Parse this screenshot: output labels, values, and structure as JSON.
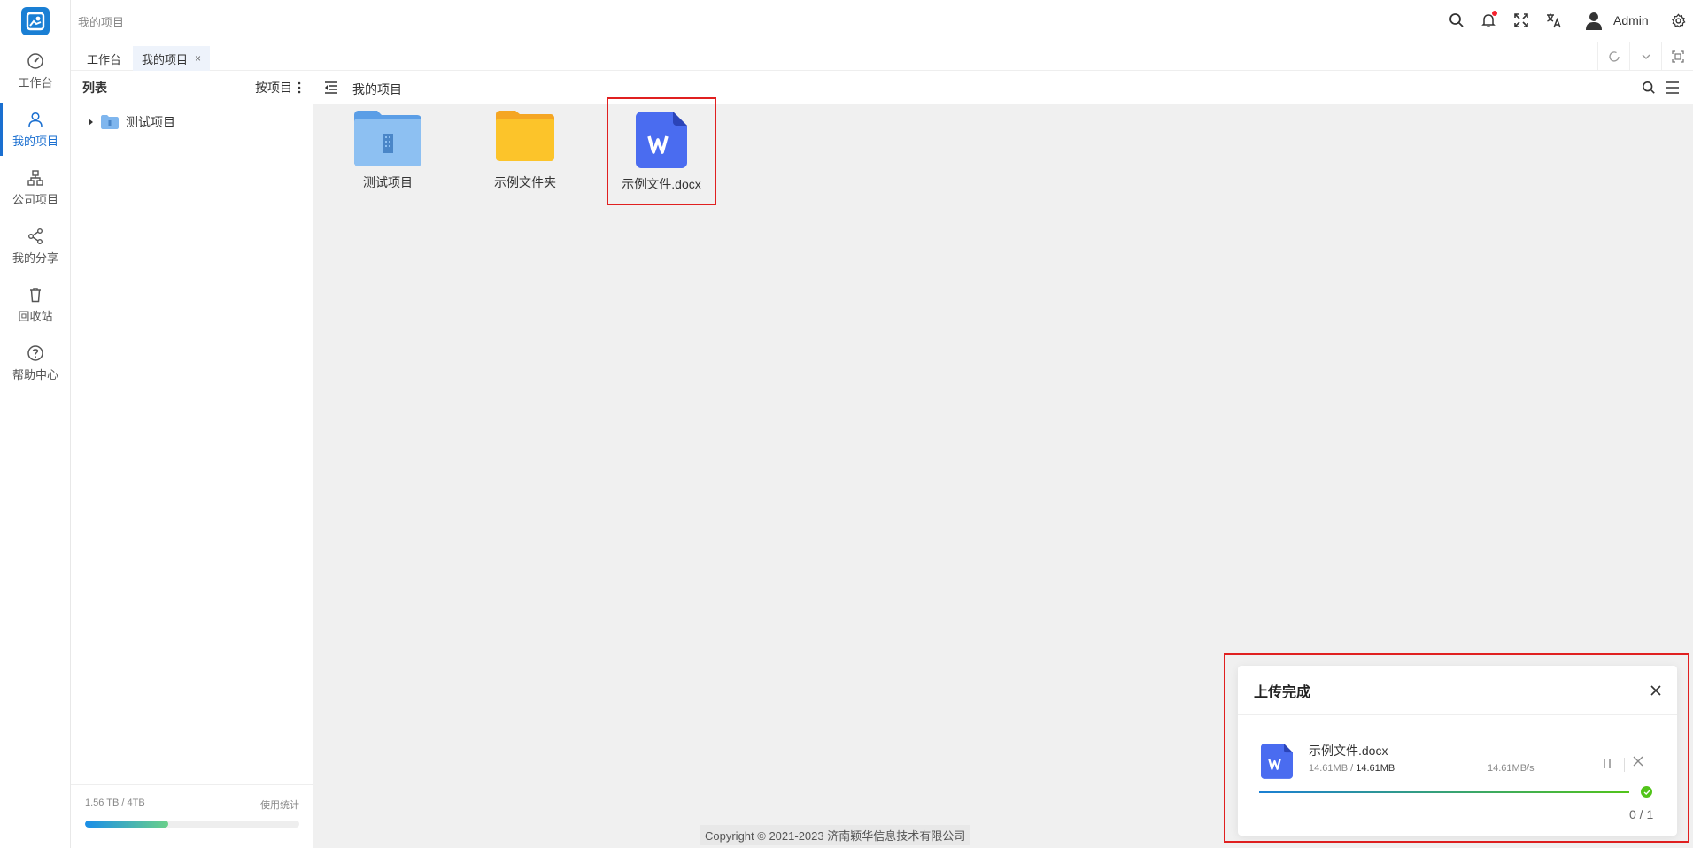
{
  "nav": {
    "items": [
      {
        "label": "工作台",
        "icon": "dashboard-icon"
      },
      {
        "label": "我的项目",
        "icon": "user-icon"
      },
      {
        "label": "公司项目",
        "icon": "org-chart-icon"
      },
      {
        "label": "我的分享",
        "icon": "share-icon"
      },
      {
        "label": "回收站",
        "icon": "trash-icon"
      },
      {
        "label": "帮助中心",
        "icon": "help-icon"
      }
    ],
    "active_index": 1,
    "accent": "#1a6fd0"
  },
  "topbar": {
    "breadcrumb": "我的项目",
    "user": "Admin"
  },
  "tabs": [
    {
      "label": "工作台",
      "active": false
    },
    {
      "label": "我的项目",
      "active": true,
      "close": "×"
    }
  ],
  "sidepanel": {
    "title": "列表",
    "sort_label": "按项目",
    "tree": [
      {
        "label": "测试项目"
      }
    ],
    "usage_text": "1.56 TB / 4TB",
    "usage_link": "使用统计",
    "usage_fraction": 0.39
  },
  "main": {
    "title": "我的项目",
    "items": [
      {
        "label": "测试项目",
        "type": "project-folder"
      },
      {
        "label": "示例文件夹",
        "type": "folder"
      },
      {
        "label": "示例文件.docx",
        "type": "word-file",
        "highlighted": true
      }
    ],
    "copyright": "Copyright © 2021-2023 济南颖华信息技术有限公司"
  },
  "upload": {
    "title": "上传完成",
    "file_name": "示例文件.docx",
    "uploaded": "14.61MB",
    "separator": " / ",
    "total": "14.61MB",
    "speed": "14.61MB/s",
    "progress": 1.0,
    "count": "0 / 1"
  }
}
